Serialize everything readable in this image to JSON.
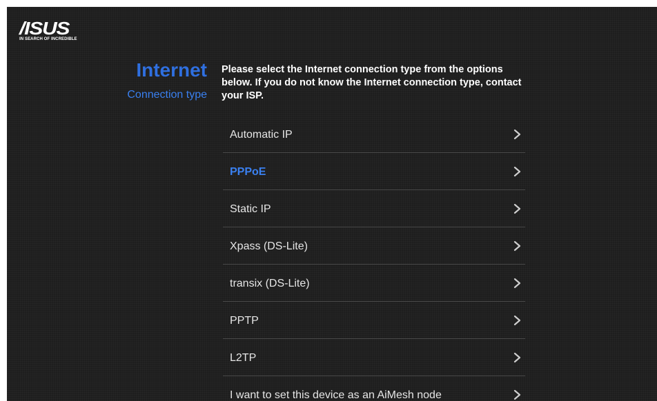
{
  "brand": {
    "logo_text": "/ISUS",
    "tagline": "IN SEARCH OF INCREDIBLE"
  },
  "header": {
    "title": "Internet",
    "subtitle": "Connection type"
  },
  "description": "Please select the Internet connection type from the options below. If you do not know the Internet connection type, contact your ISP.",
  "options": [
    {
      "label": "Automatic IP",
      "selected": false
    },
    {
      "label": "PPPoE",
      "selected": true
    },
    {
      "label": "Static IP",
      "selected": false
    },
    {
      "label": "Xpass (DS-Lite)",
      "selected": false
    },
    {
      "label": "transix (DS-Lite)",
      "selected": false
    },
    {
      "label": "PPTP",
      "selected": false
    },
    {
      "label": "L2TP",
      "selected": false
    },
    {
      "label": "I want to set this device as an AiMesh node",
      "selected": false
    }
  ],
  "icons": {
    "option_arrow": "chevron-right-icon"
  },
  "colors": {
    "background": "#1e1e1e",
    "accent": "#3a80f0",
    "title": "#2f6fdf",
    "text": "#ffffff",
    "divider": "#4a4a4a"
  }
}
